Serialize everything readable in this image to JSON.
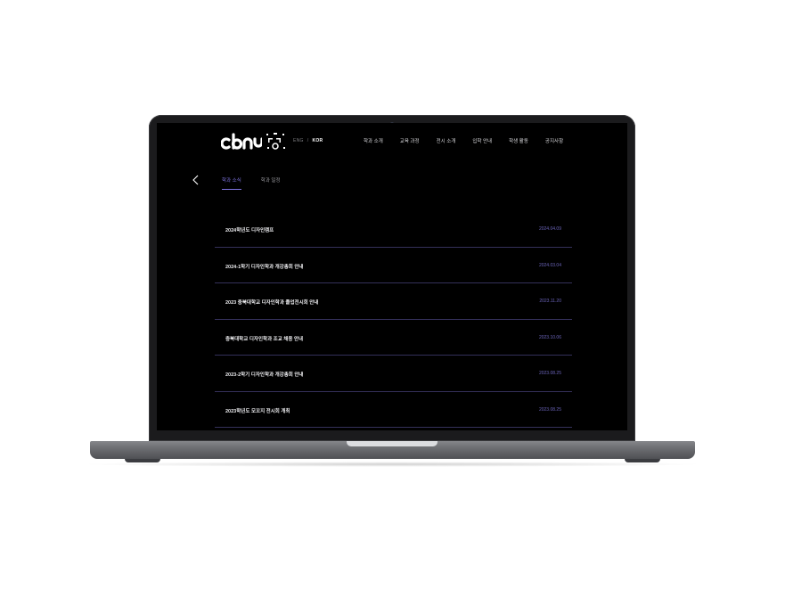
{
  "header": {
    "logo_alt": "cbnu",
    "lang": {
      "eng": "ENG",
      "separator": "/",
      "kor": "KOR"
    },
    "nav": [
      "학과 소개",
      "교육 과정",
      "전시 소개",
      "입학 안내",
      "학생 활동",
      "공지사항"
    ]
  },
  "subnav": {
    "back_icon": "chevron-left-icon",
    "tabs": [
      {
        "label": "학과 소식",
        "active": true
      },
      {
        "label": "학과 일정",
        "active": false
      }
    ]
  },
  "notices": [
    {
      "title": "2024학년도 디자인캠프",
      "date": "2024.04.09"
    },
    {
      "title": "2024-1학기 디자인학과 개강총회 안내",
      "date": "2024.03.04"
    },
    {
      "title": "2023 충북대학교 디자인학과 졸업전시회 안내",
      "date": "2023.11.20"
    },
    {
      "title": "충북대학교 디자인학과 조교 채용 안내",
      "date": "2023.10.06"
    },
    {
      "title": "2023-2학기 디자인학과 개강총회 안내",
      "date": "2023.08.25"
    },
    {
      "title": "2023학년도 모꼬지 전시회 개최",
      "date": "2023.08.25"
    }
  ],
  "colors": {
    "accent": "#7f74e0",
    "date": "#6a63b8",
    "divider": "#34305a",
    "screen_bg": "#000000"
  }
}
